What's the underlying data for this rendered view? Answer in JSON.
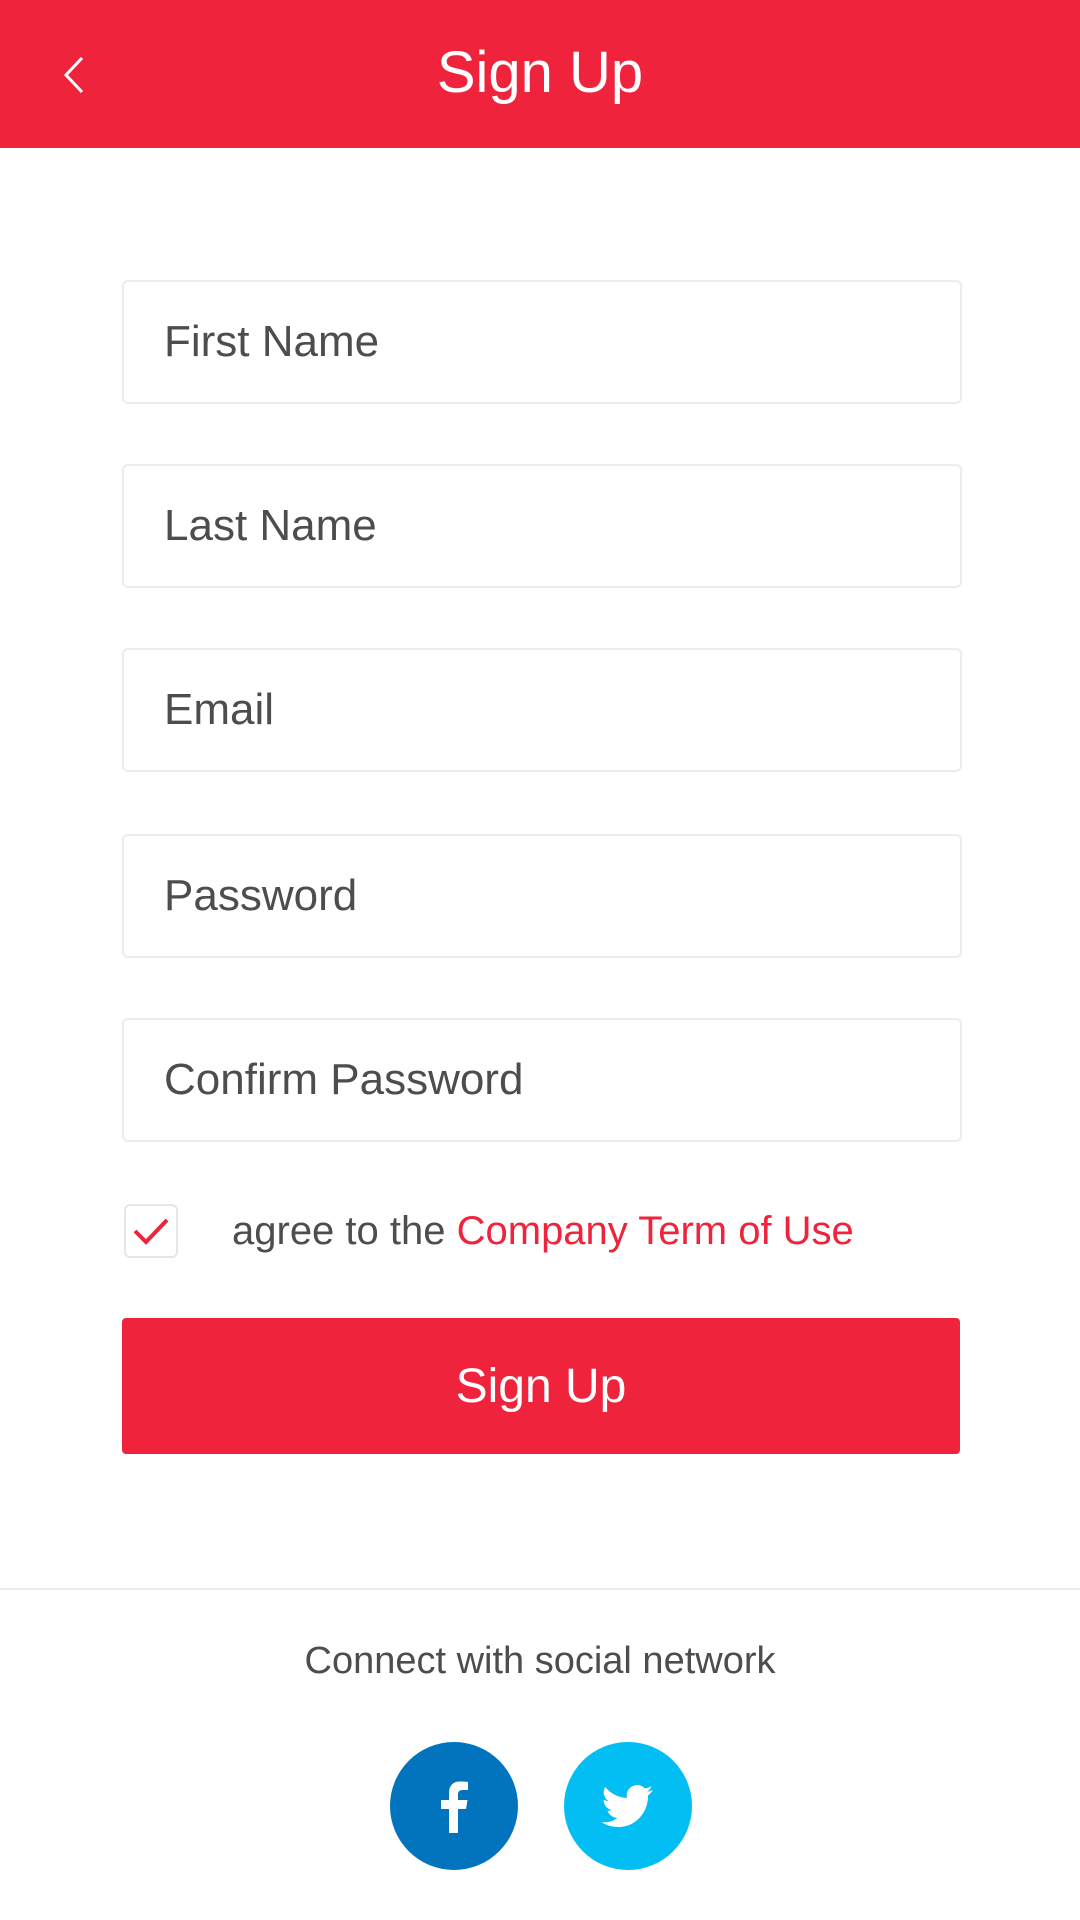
{
  "header": {
    "title": "Sign Up",
    "back_icon": "chevron-left-icon",
    "background_color": "#ef233c"
  },
  "form": {
    "fields": [
      {
        "name": "first-name",
        "placeholder": "First Name",
        "value": ""
      },
      {
        "name": "last-name",
        "placeholder": "Last Name",
        "value": ""
      },
      {
        "name": "email",
        "placeholder": "Email",
        "value": ""
      },
      {
        "name": "password",
        "placeholder": "Password",
        "value": ""
      },
      {
        "name": "confirm-password",
        "placeholder": "Confirm Password",
        "value": ""
      }
    ],
    "terms": {
      "checked": true,
      "prefix": "agree to the ",
      "link_text": "Company Term of Use"
    },
    "submit_label": "Sign Up"
  },
  "social": {
    "label": "Connect with social network",
    "buttons": [
      {
        "icon": "facebook-icon",
        "color": "#0274be"
      },
      {
        "icon": "twitter-icon",
        "color": "#03bef3"
      }
    ]
  },
  "colors": {
    "accent": "#ef233c",
    "text": "#4d4d4d"
  }
}
